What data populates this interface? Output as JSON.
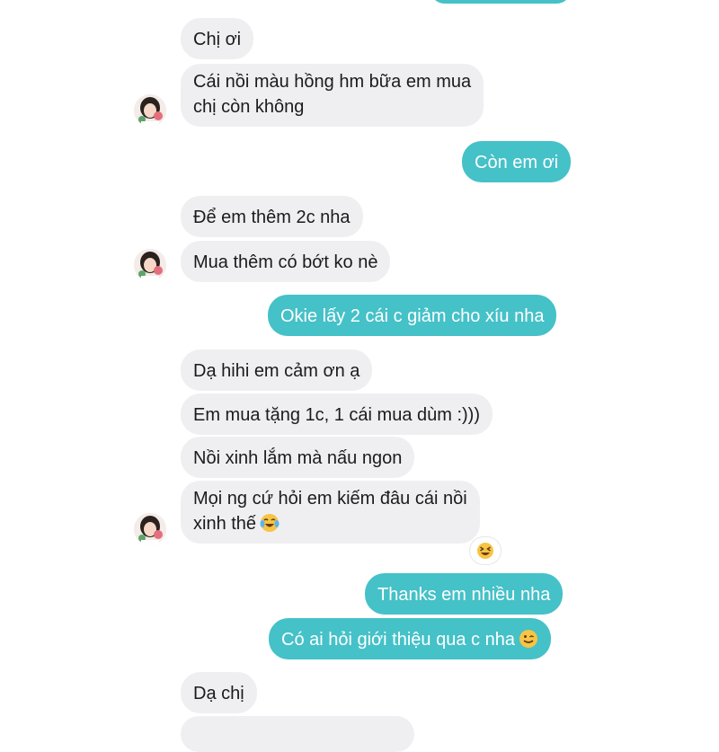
{
  "messages": [
    {
      "id": "m0",
      "text": ""
    },
    {
      "id": "m1",
      "text": "Chị ơi"
    },
    {
      "id": "m2a",
      "text": "Cái nồi màu hồng hm bữa em mua"
    },
    {
      "id": "m2b",
      "text": "chị còn không"
    },
    {
      "id": "m3",
      "text": "Còn em ơi"
    },
    {
      "id": "m4",
      "text": "Để em thêm 2c nha"
    },
    {
      "id": "m5",
      "text": "Mua thêm có bớt ko nè"
    },
    {
      "id": "m6",
      "text": "Okie lấy 2 cái c giảm cho xíu nha"
    },
    {
      "id": "m7",
      "text": "Dạ hihi em cảm ơn ạ"
    },
    {
      "id": "m8",
      "text": "Em mua tặng 1c, 1 cái mua dùm :)))"
    },
    {
      "id": "m9",
      "text": "Nồi xinh lắm mà nấu ngon"
    },
    {
      "id": "m10a",
      "text": "Mọi ng cứ hỏi em kiếm đâu cái nồi"
    },
    {
      "id": "m10b",
      "text": "xinh thế"
    },
    {
      "id": "m11",
      "text": "Thanks em nhiều nha"
    },
    {
      "id": "m12",
      "text": "Có ai hỏi giới thiệu qua c nha"
    },
    {
      "id": "m13",
      "text": "Dạ chị"
    }
  ],
  "emojis": {
    "m10": "face-with-tears-of-joy-icon",
    "m12": "winking-face-icon",
    "reaction": "laughing-squinting-face-icon"
  },
  "colors": {
    "incoming_bubble": "#efeff1",
    "outgoing_bubble": "#45c1c8",
    "incoming_text": "#1b1b1b",
    "outgoing_text": "#ffffff"
  }
}
